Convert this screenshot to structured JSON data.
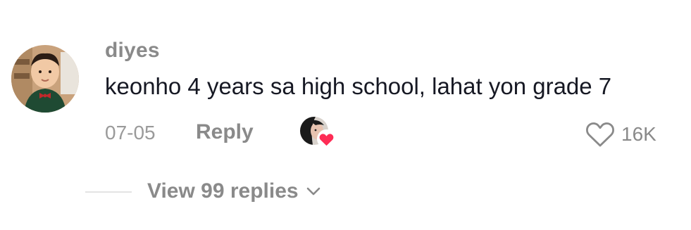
{
  "comment": {
    "username": "diyes",
    "text": "keonho 4 years sa high school, lahat yon grade 7",
    "date": "07-05",
    "reply_label": "Reply",
    "like_count": "16K",
    "liked_by_creator": true,
    "like_icon": "heart-outline-icon",
    "creator_like_icon": "heart-filled-icon"
  },
  "replies": {
    "label": "View 99 replies",
    "icon": "chevron-down-icon"
  },
  "colors": {
    "text_primary": "#161823",
    "text_secondary": "#8a8a8a",
    "heart_red": "#fe2c55",
    "divider": "#e3e3e3"
  }
}
